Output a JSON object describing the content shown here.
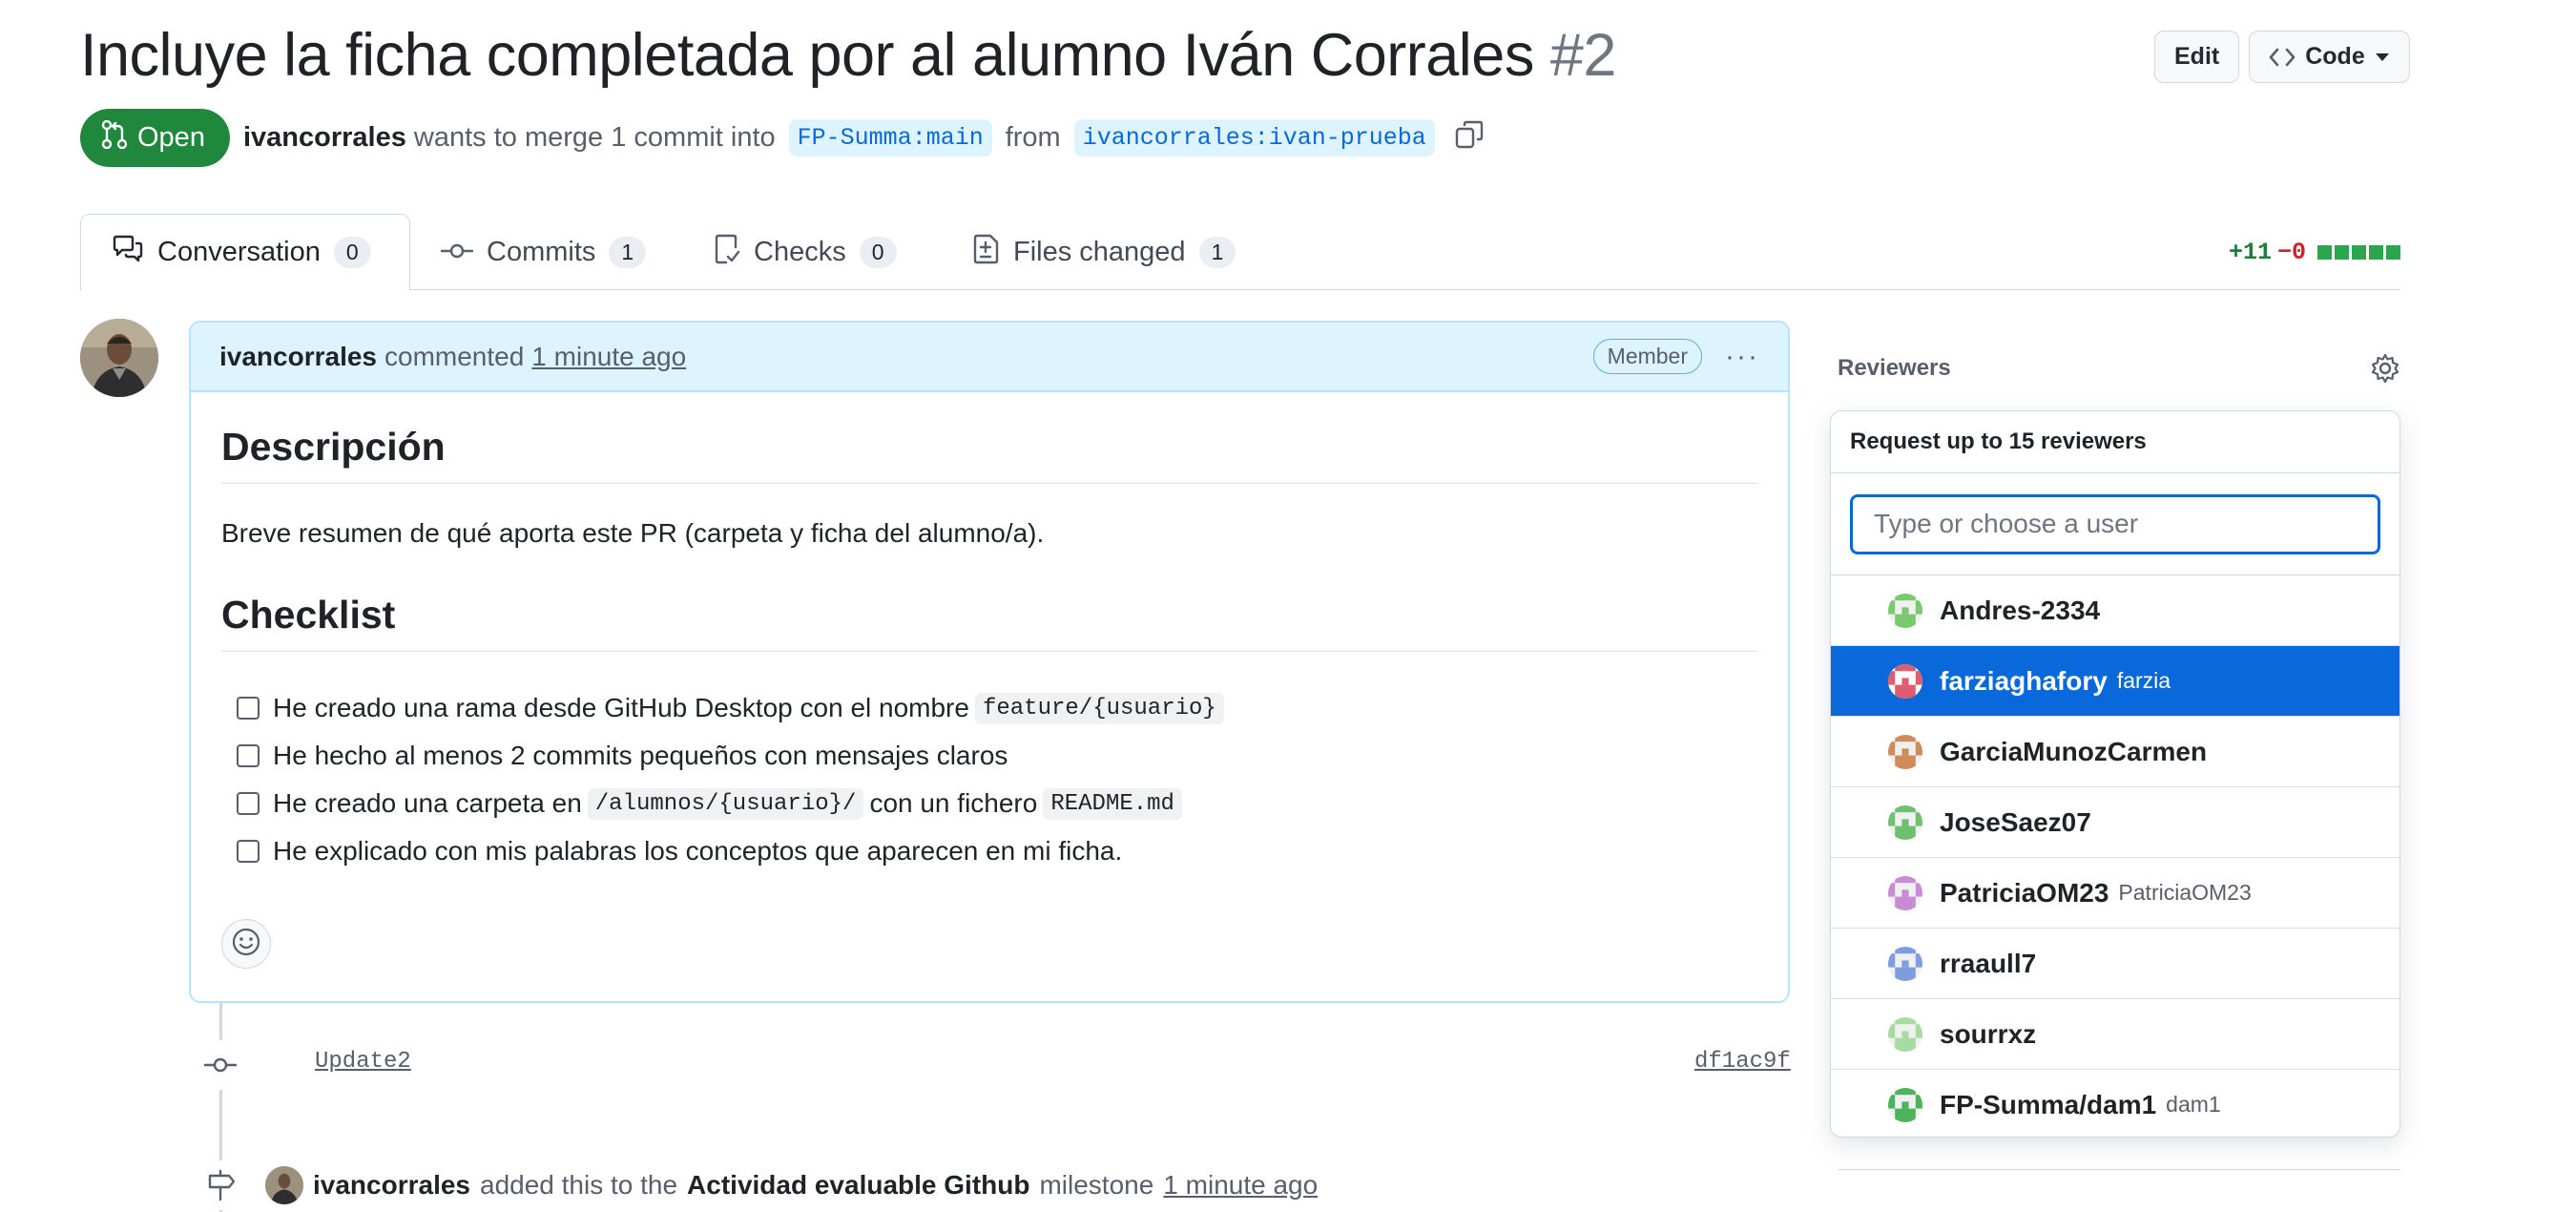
{
  "pr": {
    "title": "Incluye la ficha completada por al alumno Iván Corrales",
    "number": "#2",
    "state": "Open",
    "author": "ivancorrales",
    "merge_text": "wants to merge 1 commit into",
    "base_branch": "FP-Summa:main",
    "from_text": "from",
    "head_branch": "ivancorrales:ivan-prueba"
  },
  "header_buttons": {
    "edit": "Edit",
    "code": "Code"
  },
  "tabs": [
    {
      "label": "Conversation",
      "count": "0"
    },
    {
      "label": "Commits",
      "count": "1"
    },
    {
      "label": "Checks",
      "count": "0"
    },
    {
      "label": "Files changed",
      "count": "1"
    }
  ],
  "diffstat": {
    "additions": "+11",
    "deletions": "−0"
  },
  "comment": {
    "author": "ivancorrales",
    "action": "commented",
    "time": "1 minute ago",
    "badge": "Member",
    "more": "···",
    "heading1": "Descripción",
    "paragraph": "Breve resumen de qué aporta este PR (carpeta y ficha del alumno/a).",
    "heading2": "Checklist",
    "checklist": [
      {
        "before": "He creado una rama desde GitHub Desktop con el nombre",
        "code": "feature/{usuario}",
        "middle": "",
        "code2": "",
        "after": ""
      },
      {
        "before": "He hecho al menos 2 commits pequeños con mensajes claros",
        "code": "",
        "middle": "",
        "code2": "",
        "after": ""
      },
      {
        "before": "He creado una carpeta en",
        "code": "/alumnos/{usuario}/",
        "middle": "con un fichero",
        "code2": "README.md",
        "after": ""
      },
      {
        "before": "He explicado con mis palabras los conceptos que aparecen en mi ficha.",
        "code": "",
        "middle": "",
        "code2": "",
        "after": ""
      }
    ]
  },
  "timeline": {
    "commit_message": "Update2",
    "commit_sha": "df1ac9f",
    "event_author": "ivancorrales",
    "event_text": "added this to the",
    "milestone": "Actividad evaluable Github",
    "event_suffix": "milestone",
    "event_time": "1 minute ago"
  },
  "sidebar": {
    "reviewers_label": "Reviewers",
    "popover": {
      "header": "Request up to 15 reviewers",
      "search_placeholder": "Type or choose a user",
      "users": [
        {
          "name": "Andres-2334",
          "sub": "",
          "color": "#7bc96f",
          "selected": false
        },
        {
          "name": "farziaghafory",
          "sub": "farzia",
          "color": "#e05d6f",
          "selected": true
        },
        {
          "name": "GarciaMunozCarmen",
          "sub": "",
          "color": "#d08b5b",
          "selected": false
        },
        {
          "name": "JoseSaez07",
          "sub": "",
          "color": "#6cc070",
          "selected": false
        },
        {
          "name": "PatriciaOM23",
          "sub": "PatriciaOM23",
          "color": "#c98bd6",
          "selected": false
        },
        {
          "name": "rraaull7",
          "sub": "",
          "color": "#7d9de0",
          "selected": false
        },
        {
          "name": "sourrxz",
          "sub": "",
          "color": "#a6dca0",
          "selected": false
        },
        {
          "name": "FP-Summa/dam1",
          "sub": "dam1",
          "color": "#4cb45a",
          "selected": false
        }
      ]
    }
  },
  "colors": {
    "open_green": "#1f883d",
    "link_blue": "#0969da",
    "selected_row": "#0969da",
    "comment_header_bg": "#ddf4ff"
  }
}
